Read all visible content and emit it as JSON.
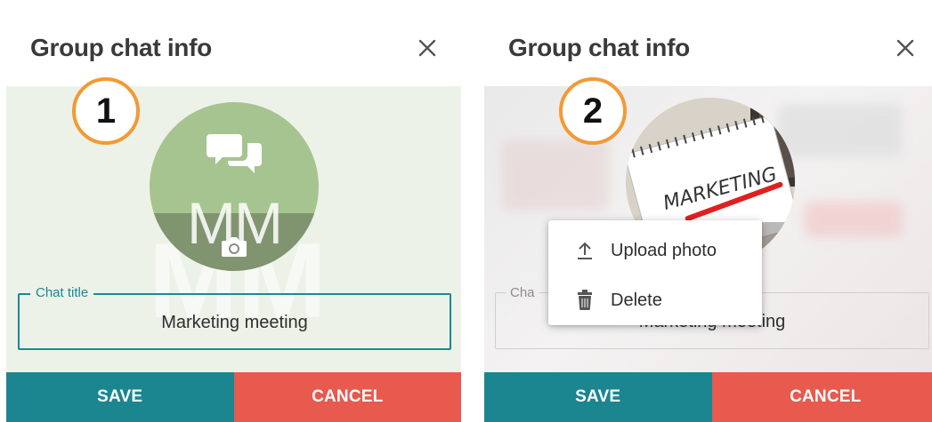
{
  "colors": {
    "accent": "#1b8590",
    "cancel": "#e8594e",
    "badge_ring": "#f29a35",
    "avatar_green": "#a6c48f",
    "body_green": "#edf2e8"
  },
  "panels": [
    {
      "title": "Group chat info",
      "step": "1",
      "avatar": {
        "initials": "MM"
      },
      "chat_title": {
        "label": "Chat title",
        "value": "Marketing meeting"
      },
      "footer": {
        "save": "SAVE",
        "cancel": "CANCEL"
      }
    },
    {
      "title": "Group chat info",
      "step": "2",
      "avatar": {
        "photo_text": "MARKETING"
      },
      "chat_title": {
        "label": "Cha",
        "value": "Marketing meeting"
      },
      "menu": [
        {
          "label": "Upload photo",
          "icon": "upload-icon"
        },
        {
          "label": "Delete",
          "icon": "trash-icon"
        }
      ],
      "footer": {
        "save": "SAVE",
        "cancel": "CANCEL"
      }
    }
  ]
}
